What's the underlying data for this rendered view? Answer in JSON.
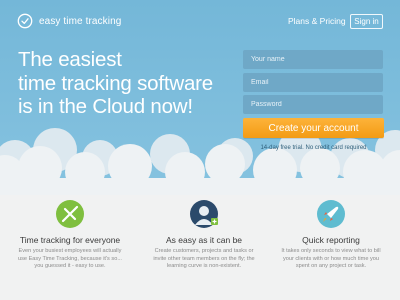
{
  "header": {
    "logo_text": "easy time tracking",
    "nav_plans": "Plans & Pricing",
    "signin_label": "Sign in"
  },
  "hero": {
    "headline_lines": [
      "The easiest",
      "time tracking software",
      "is in the Cloud now!"
    ]
  },
  "signup_form": {
    "name_placeholder": "Your name",
    "email_placeholder": "Email",
    "password_placeholder": "Password",
    "cta_label": "Create your account",
    "trial_note": "14-day free trial. No credit card required"
  },
  "features": [
    {
      "icon": "stopwatch-check-icon",
      "title": "Time tracking for everyone",
      "description_lines": [
        "Even your busiest employees will actually",
        "use Easy Time Tracking, because it's so...",
        "you guessed it - easy to use."
      ]
    },
    {
      "icon": "user-add-icon",
      "title": "As easy as it can be",
      "description_lines": [
        "Create customers, projects and tasks or",
        "invite other team members on the fly; the",
        "learning curve is non-existent."
      ]
    },
    {
      "icon": "rocket-icon",
      "title": "Quick reporting",
      "description_lines": [
        "It takes only seconds to view what to bill",
        "your clients with or how much time you",
        "spent on any project or task."
      ]
    }
  ],
  "colors": {
    "sky": "#7fbfdf",
    "accent_orange": "#f7a21f",
    "icon_green": "#7fbf3f",
    "icon_navy": "#2b4a6b",
    "icon_teal": "#5fbcd0"
  }
}
